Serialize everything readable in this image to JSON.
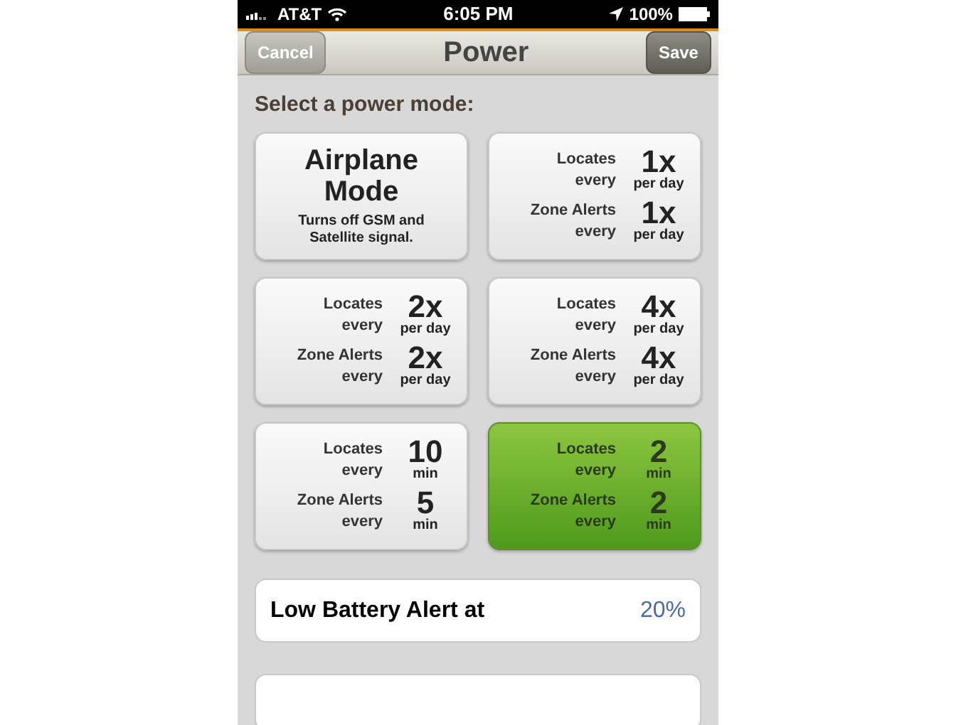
{
  "status_bar": {
    "carrier": "AT&T",
    "time": "6:05 PM",
    "battery": "100%"
  },
  "nav_bar": {
    "left_button": "Cancel",
    "title": "Power",
    "right_button": "Save"
  },
  "section_title": "Select a power mode:",
  "modes": [
    {
      "kind": "airplane",
      "selected": false,
      "title": "Airplane Mode",
      "description": "Turns off GSM and Satellite signal."
    },
    {
      "kind": "schedule",
      "selected": false,
      "rows": [
        {
          "label": "Locates",
          "sublabel": "every",
          "value": "1x",
          "unit": "per day"
        },
        {
          "label": "Zone Alerts",
          "sublabel": "every",
          "value": "1x",
          "unit": "per day"
        }
      ]
    },
    {
      "kind": "schedule",
      "selected": false,
      "rows": [
        {
          "label": "Locates",
          "sublabel": "every",
          "value": "2x",
          "unit": "per day"
        },
        {
          "label": "Zone Alerts",
          "sublabel": "every",
          "value": "2x",
          "unit": "per day"
        }
      ]
    },
    {
      "kind": "schedule",
      "selected": false,
      "rows": [
        {
          "label": "Locates",
          "sublabel": "every",
          "value": "4x",
          "unit": "per day"
        },
        {
          "label": "Zone Alerts",
          "sublabel": "every",
          "value": "4x",
          "unit": "per day"
        }
      ]
    },
    {
      "kind": "schedule",
      "selected": false,
      "rows": [
        {
          "label": "Locates",
          "sublabel": "every",
          "value": "10",
          "unit": "min"
        },
        {
          "label": "Zone Alerts",
          "sublabel": "every",
          "value": "5",
          "unit": "min"
        }
      ]
    },
    {
      "kind": "schedule",
      "selected": true,
      "rows": [
        {
          "label": "Locates",
          "sublabel": "every",
          "value": "2",
          "unit": "min"
        },
        {
          "label": "Zone Alerts",
          "sublabel": "every",
          "value": "2",
          "unit": "min"
        }
      ]
    }
  ],
  "low_battery": {
    "label": "Low Battery Alert at",
    "value": "20%"
  }
}
